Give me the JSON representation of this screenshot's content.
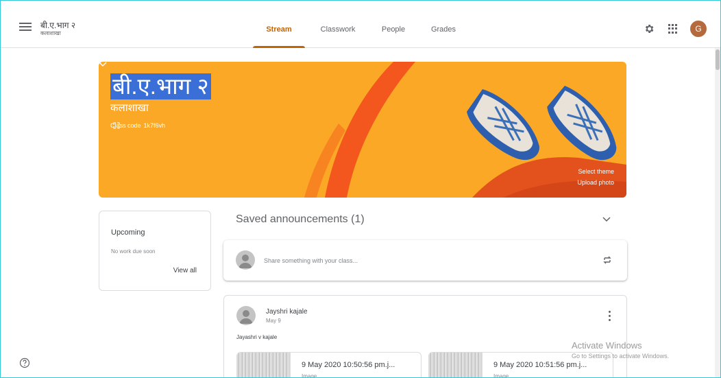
{
  "header": {
    "class_title": "बी.ए.भाग २",
    "class_subtitle": "कलाशाखा",
    "tabs": [
      {
        "label": "Stream",
        "active": true
      },
      {
        "label": "Classwork",
        "active": false
      },
      {
        "label": "People",
        "active": false
      },
      {
        "label": "Grades",
        "active": false
      }
    ],
    "avatar_letter": "G",
    "icons": [
      "menu-icon",
      "gear-icon",
      "apps-grid-icon"
    ]
  },
  "banner": {
    "title": "बी.ए.भाग २",
    "subtitle": "कलाशाखा",
    "class_code_label": "Class code",
    "class_code": "1k7f6vh",
    "select_theme": "Select theme",
    "upload_photo": "Upload photo",
    "color": "#fba826"
  },
  "upcoming": {
    "title": "Upcoming",
    "empty_text": "No work due soon",
    "view_all": "View all"
  },
  "stream": {
    "saved_announcements": "Saved announcements (1)",
    "share_placeholder": "Share something with your class...",
    "post": {
      "author": "Jayshri kajale",
      "date": "May 9",
      "body": "Jayashri v kajale",
      "attachments": [
        {
          "name": "9 May 2020 10:50:56 pm.j...",
          "type": "Image"
        },
        {
          "name": "9 May 2020 10:51:56 pm.j...",
          "type": "Image"
        }
      ]
    }
  },
  "watermark": {
    "line1": "Activate Windows",
    "line2": "Go to Settings to activate Windows."
  },
  "colors": {
    "accent": "#c26401",
    "banner_bg": "#fba826",
    "avatar_bg": "#b46a3c"
  }
}
